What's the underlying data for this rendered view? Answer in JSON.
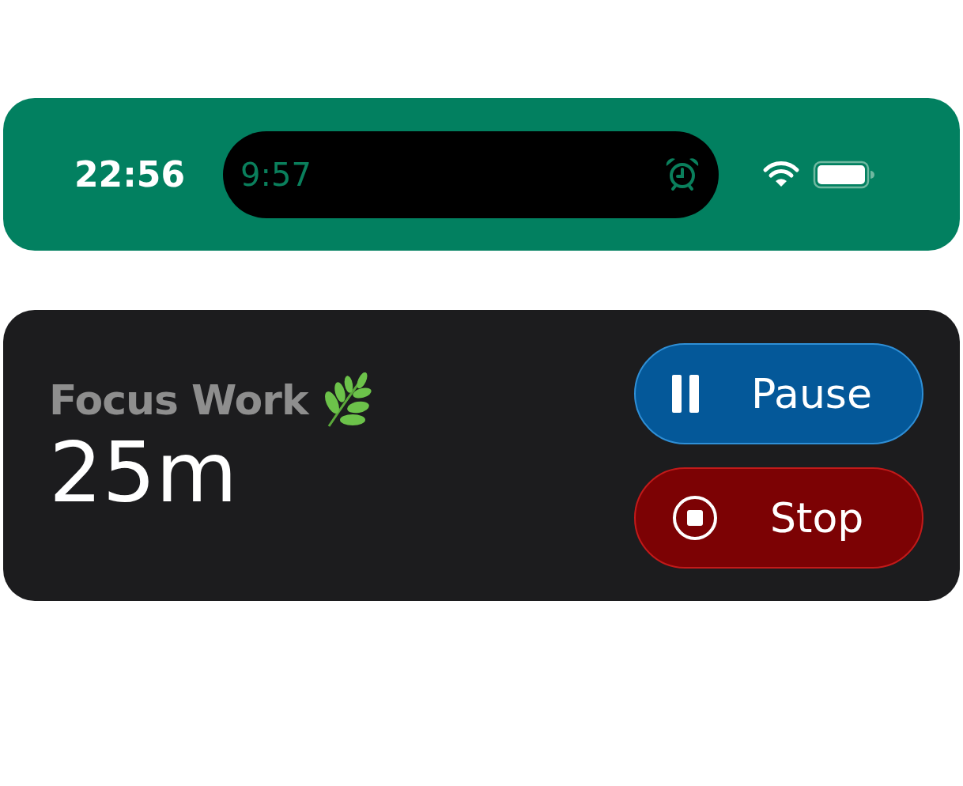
{
  "status_bar": {
    "time": "22:56",
    "island": {
      "time": "9:57"
    }
  },
  "activity": {
    "title": "Focus Work",
    "duration": "25m",
    "buttons": [
      {
        "kind": "pause",
        "label": "Pause"
      },
      {
        "kind": "stop",
        "label": "Stop"
      }
    ]
  }
}
